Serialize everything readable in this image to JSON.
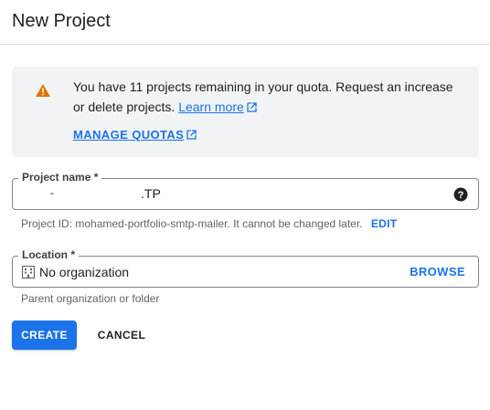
{
  "header": {
    "title": "New Project"
  },
  "alert": {
    "message": "You have 11 projects remaining in your quota. Request an increase or delete projects.",
    "learn_more": "Learn more",
    "manage_quotas": "MANAGE QUOTAS",
    "warning_icon": "warning-icon",
    "external_icon": "open-in-new-icon",
    "warning_color": "#e37400"
  },
  "project_name": {
    "label": "Project name *",
    "value_start": "-",
    "value_end": ".TP",
    "help_icon": "help-icon"
  },
  "project_id": {
    "text": "Project ID: mohamed-portfolio-smtp-mailer. It cannot be changed later.",
    "edit": "EDIT"
  },
  "location": {
    "label": "Location *",
    "value": "No organization",
    "browse": "BROWSE",
    "icon": "building-icon",
    "helper": "Parent organization or folder"
  },
  "actions": {
    "create": "CREATE",
    "cancel": "CANCEL"
  },
  "colors": {
    "accent": "#1a73e8",
    "alert_bg": "#f1f3f4"
  }
}
